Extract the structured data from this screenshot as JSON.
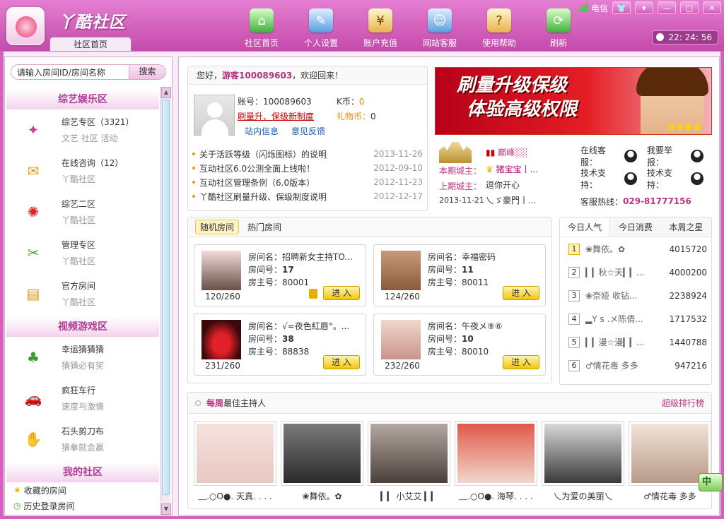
{
  "app": {
    "brand": "丫酷社区",
    "home_tab": "社区首页"
  },
  "nav": [
    {
      "label": "社区首页",
      "icon": "home-icon"
    },
    {
      "label": "个人设置",
      "icon": "settings-icon"
    },
    {
      "label": "账户充值",
      "icon": "recharge-icon"
    },
    {
      "label": "网站客服",
      "icon": "support-icon"
    },
    {
      "label": "使用帮助",
      "icon": "help-icon"
    },
    {
      "label": "刷新",
      "icon": "refresh-icon"
    }
  ],
  "system": {
    "carrier": "电信",
    "time": "22: 24: 56"
  },
  "search": {
    "placeholder": "请输入房间ID/房间名称",
    "button": "搜索"
  },
  "sidebar": {
    "sections": [
      {
        "title": "综艺娱乐区",
        "items": [
          {
            "name": "综艺专区",
            "count": "（3321）",
            "sub": "文艺 社区 活动",
            "icon": "variety-icon"
          },
          {
            "name": "在线咨询",
            "count": "（12）",
            "sub": "丫酷社区",
            "icon": "consult-icon"
          },
          {
            "name": "综艺二区",
            "count": "",
            "sub": "丫酷社区",
            "icon": "firework-icon"
          },
          {
            "name": "管理专区",
            "count": "",
            "sub": "丫酷社区",
            "icon": "manage-icon"
          },
          {
            "name": "官方房间",
            "count": "",
            "sub": "丫酷社区",
            "icon": "official-icon"
          }
        ]
      },
      {
        "title": "视频游戏区",
        "items": [
          {
            "name": "幸运猜猜猜",
            "count": "",
            "sub": "猜猜必有奖",
            "icon": "lucky-icon"
          },
          {
            "name": "疯狂车行",
            "count": "",
            "sub": "速度与激情",
            "icon": "car-icon"
          },
          {
            "name": "石头剪刀布",
            "count": "",
            "sub": "猜拳就会赢",
            "icon": "hand-icon"
          }
        ]
      }
    ],
    "mine": {
      "title": "我的社区",
      "items": [
        "收藏的房间",
        "历史登录房间"
      ]
    }
  },
  "welcome": {
    "greeting_pre": "您好，",
    "user": "游客100089603",
    "greeting_post": "，欢迎回来！",
    "account_label": "账号：",
    "account": "100089603",
    "upgrade_link": "刷量升、保级新制度",
    "kcoin_label": "K币：",
    "kcoin": "0",
    "gift_label": "礼物币：",
    "gift": "0",
    "link_msg": "站内信息",
    "link_feedback": "意见反馈"
  },
  "news": [
    {
      "text": "关于活跃等级（闪烁图标）的说明",
      "date": "2013-11-26"
    },
    {
      "text": "互动社区6.0公测全面上线啦！",
      "date": "2012-09-10"
    },
    {
      "text": "互动社区管理条例（6.0版本）",
      "date": "2012-11-23"
    },
    {
      "text": "丫酷社区刷量升级、保级制度说明",
      "date": "2012-12-17"
    }
  ],
  "banner": {
    "line1": "刷量升级保级",
    "line2": "体验高级权限"
  },
  "castle": {
    "current_label": "本期城主：",
    "previous_label": "上期城主：",
    "top_name": "巅峰░░",
    "current_name": "猪宝宝丨...",
    "previous_name": "逗你开心",
    "previous_name2": "乀ゞ豪門丨...",
    "date": "2013-11-21"
  },
  "service": {
    "online": "在线客服：",
    "report": "我要举报：",
    "tech1": "技术支持：",
    "tech2": "技术支持：",
    "hotline_label": "客服热线：",
    "hotline": "029-81777156"
  },
  "room_tabs": [
    "随机房间",
    "热门房间"
  ],
  "rooms": [
    {
      "name": "招聘新女主持TO...",
      "id": "17",
      "owner": "80001",
      "count": "120/260",
      "locked": true,
      "color": "#6a4f4a"
    },
    {
      "name": "幸福密码",
      "id": "11",
      "owner": "80011",
      "count": "124/260",
      "locked": false,
      "color": "#8a5a3a"
    },
    {
      "name": "√≈夜色紅唇°。...",
      "id": "38",
      "owner": "88838",
      "count": "231/260",
      "locked": false,
      "color": "#b01020"
    },
    {
      "name": "午夜メ⑨⑥",
      "id": "10",
      "owner": "80010",
      "count": "232/260",
      "locked": false,
      "color": "#d9b4a8"
    }
  ],
  "room_labels": {
    "name": "房间名：",
    "id": "房间号：",
    "owner": "房主号：",
    "enter": "进 入"
  },
  "rank": {
    "tabs": [
      "今日人气",
      "今日消费",
      "本周之星"
    ],
    "rows": [
      {
        "no": "1",
        "name": "❀舞依。✿",
        "value": "4015720"
      },
      {
        "no": "2",
        "name": "▎▎秋☆天▎▎...",
        "value": "4000200"
      },
      {
        "no": "3",
        "name": "❀奈娅 收钻...",
        "value": "2238924"
      },
      {
        "no": "4",
        "name": "▂Y s .メ陈倩...",
        "value": "1717532"
      },
      {
        "no": "5",
        "name": "▎▎漫☆漫▎▎...",
        "value": "1440788"
      },
      {
        "no": "6",
        "name": "♂情花毒 多多",
        "value": "947216"
      }
    ]
  },
  "hosts": {
    "title_bold": "每周",
    "title": "最佳主持人",
    "more": "超级排行榜",
    "items": [
      {
        "name": "﹏.○O●. 天真. . . .",
        "color": "#e9c7c2"
      },
      {
        "name": "❀舞依。✿",
        "color": "#3a3a3a"
      },
      {
        "name": "▎▎ 小艾艾 ▎▎",
        "color": "#6b5f5a"
      },
      {
        "name": "﹏.○O●. 海琴. . . .",
        "color": "#c0392b"
      },
      {
        "name": "乀为爱の美丽乀",
        "color": "#4a4a4a"
      },
      {
        "name": "♂情花毒 多多",
        "color": "#d8c3b5"
      }
    ]
  },
  "ime": "中"
}
